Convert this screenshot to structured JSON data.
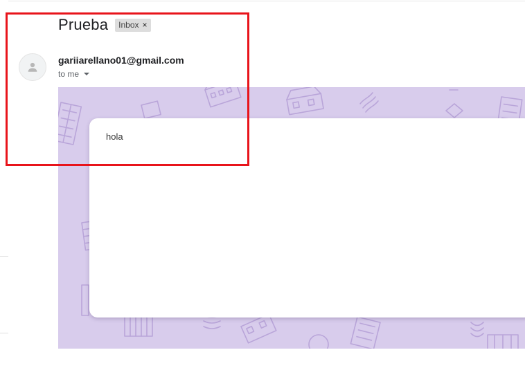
{
  "email": {
    "subject": "Prueba",
    "labels": [
      {
        "text": "Inbox",
        "remove_symbol": "×"
      }
    ],
    "sender": "gariiarellano01@gmail.com",
    "recipient": "to me",
    "body": "hola"
  },
  "icons": {
    "avatar": "person-icon",
    "recipient_details": "caret-down-icon",
    "label_remove": "close-icon"
  },
  "colors": {
    "theme_background": "#d8ccec",
    "highlight": "#e8141b",
    "label_chip": "#dddddd"
  }
}
